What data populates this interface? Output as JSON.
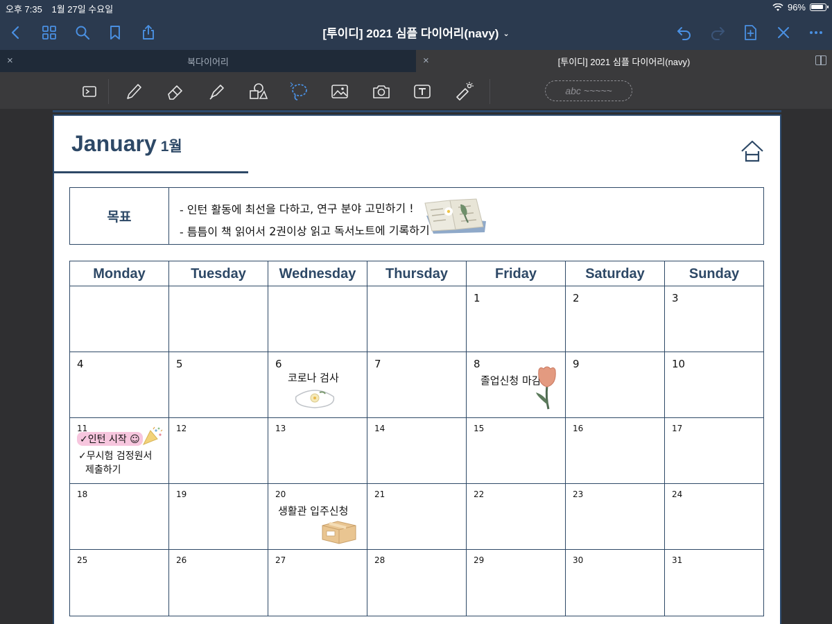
{
  "status": {
    "time": "오후 7:35",
    "date": "1월 27일 수요일",
    "battery": "96%"
  },
  "nav": {
    "title": "[투이디] 2021 심플 다이어리(navy)"
  },
  "tabs": [
    {
      "label": "북다이어리",
      "active": false
    },
    {
      "label": "[투이디] 2021 심플 다이어리(navy)",
      "active": true
    }
  ],
  "toolbar": {
    "shapes_placeholder": "abc ~~~~~"
  },
  "page": {
    "month_en": "January",
    "month_ko": "1월",
    "goal_label": "목표",
    "goals": [
      "- 인턴 활동에 최선을 다하고, 연구 분야 고민하기 !",
      "- 틈틈이 책 읽어서 2권이상 읽고 독서노트에 기록하기"
    ],
    "weekdays": [
      "Monday",
      "Tuesday",
      "Wednesday",
      "Thursday",
      "Friday",
      "Saturday",
      "Sunday"
    ],
    "weeks": [
      [
        "",
        "",
        "",
        "",
        "1",
        "2",
        "3"
      ],
      [
        "4",
        "5",
        "6",
        "7",
        "8",
        "9",
        "10"
      ],
      [
        "11",
        "12",
        "13",
        "14",
        "15",
        "16",
        "17"
      ],
      [
        "18",
        "19",
        "20",
        "21",
        "22",
        "23",
        "24"
      ],
      [
        "25",
        "26",
        "27",
        "28",
        "29",
        "30",
        "31"
      ]
    ],
    "notes": {
      "jan6": "코로나 검사",
      "jan8": "졸업신청 마감",
      "jan11_a": "✓인턴 시작 ☺",
      "jan11_b": "✓무시험 검정원서",
      "jan11_c": "제출하기",
      "jan20": "생활관 입주신청"
    }
  },
  "colors": {
    "navy": "#2d4866",
    "navbar": "#2b3a4f",
    "accent": "#4a90e2"
  }
}
